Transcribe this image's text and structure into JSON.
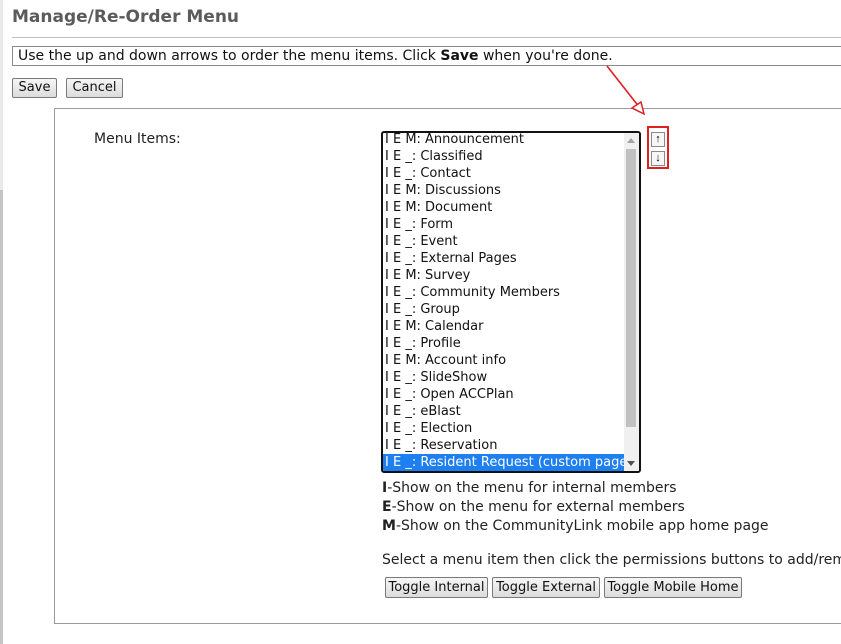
{
  "page": {
    "title": "Manage/Re-Order Menu",
    "instructions_prefix": "Use the up and down arrows to order the menu items.  Click ",
    "instructions_bold": "Save",
    "instructions_suffix": " when you're done."
  },
  "toolbar": {
    "save_label": "Save",
    "cancel_label": "Cancel"
  },
  "menu": {
    "label": "Menu Items:",
    "items": [
      "I E M: Announcement",
      "I E _: Classified",
      "I E _: Contact",
      "I E M: Discussions",
      "I E M: Document",
      "I E _: Form",
      "I E _: Event",
      "I E _: External Pages",
      "I E M: Survey",
      "I E _: Community Members",
      "I E _: Group",
      "I E M: Calendar",
      "I E _: Profile",
      "I E M: Account info",
      "I E _: SlideShow",
      "I E _: Open ACCPlan",
      "I E _: eBlast",
      "I E _: Election",
      "I E _: Reservation",
      "I E _: Resident Request (custom page)"
    ],
    "selected_index": 19,
    "move_up_icon": "↑",
    "move_down_icon": "↓"
  },
  "legend": {
    "internal_key": "I",
    "internal_text": "-Show on the menu for internal members",
    "external_key": "E",
    "external_text": "-Show on the menu for external members",
    "mobile_key": "M",
    "mobile_text": "-Show on the CommunityLink mobile app home page"
  },
  "permissions": {
    "note": "Select a menu item then click the permissions buttons to add/remove t",
    "toggle_internal_label": "Toggle Internal",
    "toggle_external_label": "Toggle External",
    "toggle_mobile_label": "Toggle Mobile Home"
  },
  "colors": {
    "selection": "#1e7ff0",
    "annotation": "#e02020"
  }
}
